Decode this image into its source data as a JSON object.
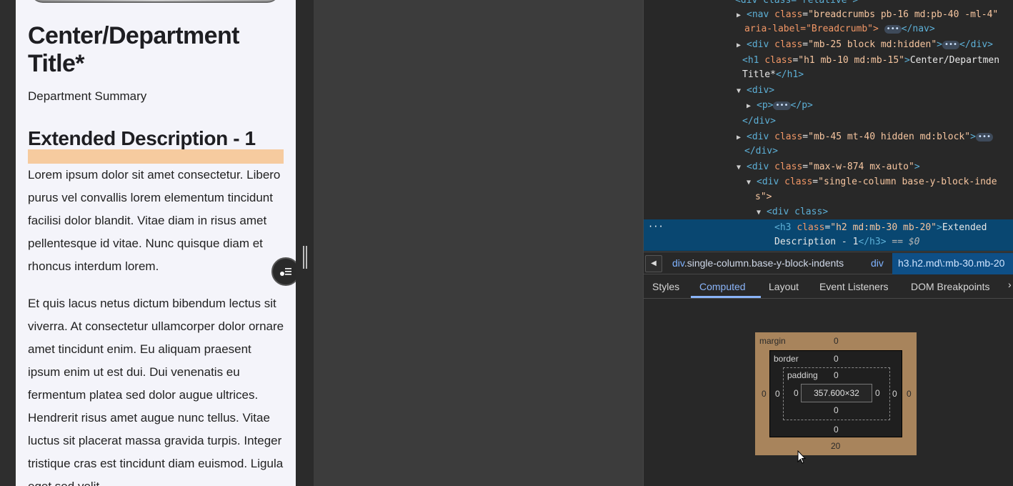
{
  "page": {
    "title": "Center/Department Title*",
    "summary": "Department Summary",
    "section_heading": "Extended Description - 1",
    "paragraph1": "Lorem ipsum dolor sit amet consectetur. Libero purus vel convallis lorem elementum tincidunt facilisi dolor blandit. Vitae diam in risus amet pellentesque id vitae. Nunc quisque diam et rhoncus interdum lorem.",
    "paragraph2": "Et quis lacus netus dictum bibendum lectus sit viverra. At consectetur ullamcorper dolor ornare amet tincidunt enim. Eu aliquam praesent ipsum enim ut est dui. Dui venenatis eu fermentum platea sed dolor augue ultrices. Hendrerit risus amet augue nunc tellus. Vitae luctus sit placerat massa gravida turpis. Integer tristique cras est tincidunt diam euismod. Ligula eget sed velit"
  },
  "elements_tree": {
    "line0": "<div class=\"relative\">",
    "line1_tag": "nav",
    "line1_class": "breadcrumbs pb-16 md:pb-40 -ml-4\"",
    "line1b": "aria-label=\"Breadcrumb\">",
    "line2_class": "mb-25 block md:hidden",
    "line3_class": "h1 mb-10 md:mb-15",
    "line3_text": "Center/Departmen",
    "line3b_text": "Title*",
    "line4": "<div>",
    "line5": "<p>",
    "line6": "</div>",
    "line7_class": "mb-45 mt-40 hidden md:block",
    "line8": "</div>",
    "line9_class": "max-w-874 mx-auto",
    "line10_class": "single-column  base-y-block-inde",
    "line10b": "s\">",
    "line11": "<div class>",
    "line12_class": "h2 md:mb-30 mb-20",
    "line12_text": "Extended",
    "line12b_text": "Description - 1",
    "line12_eq": "== $0",
    "ellipsis": "···"
  },
  "breadcrumbs": {
    "item1_el": "div",
    "item1_rest": ".single-column.base-y-block-indents",
    "item2": "div",
    "active": "h3.h2.md\\:mb-30.mb-20"
  },
  "tabs": {
    "styles": "Styles",
    "computed": "Computed",
    "layout": "Layout",
    "event_listeners": "Event Listeners",
    "dom_breakpoints": "DOM Breakpoints",
    "more": "›"
  },
  "box_model": {
    "margin_label": "margin",
    "border_label": "border",
    "padding_label": "padding",
    "margin_top": "0",
    "margin_left": "0",
    "margin_right": "0",
    "margin_bottom": "20",
    "border_top": "0",
    "border_left": "0",
    "border_right": "0",
    "border_bottom": "0",
    "padding_top": "0",
    "padding_left": "0",
    "padding_right": "0",
    "padding_bottom": "0",
    "content": "357.600×32"
  },
  "colors": {
    "selected_row": "#094771",
    "margin_highlight": "#f6c89a",
    "box_margin": "#a8845c",
    "active_tab": "#8ab4f8"
  }
}
